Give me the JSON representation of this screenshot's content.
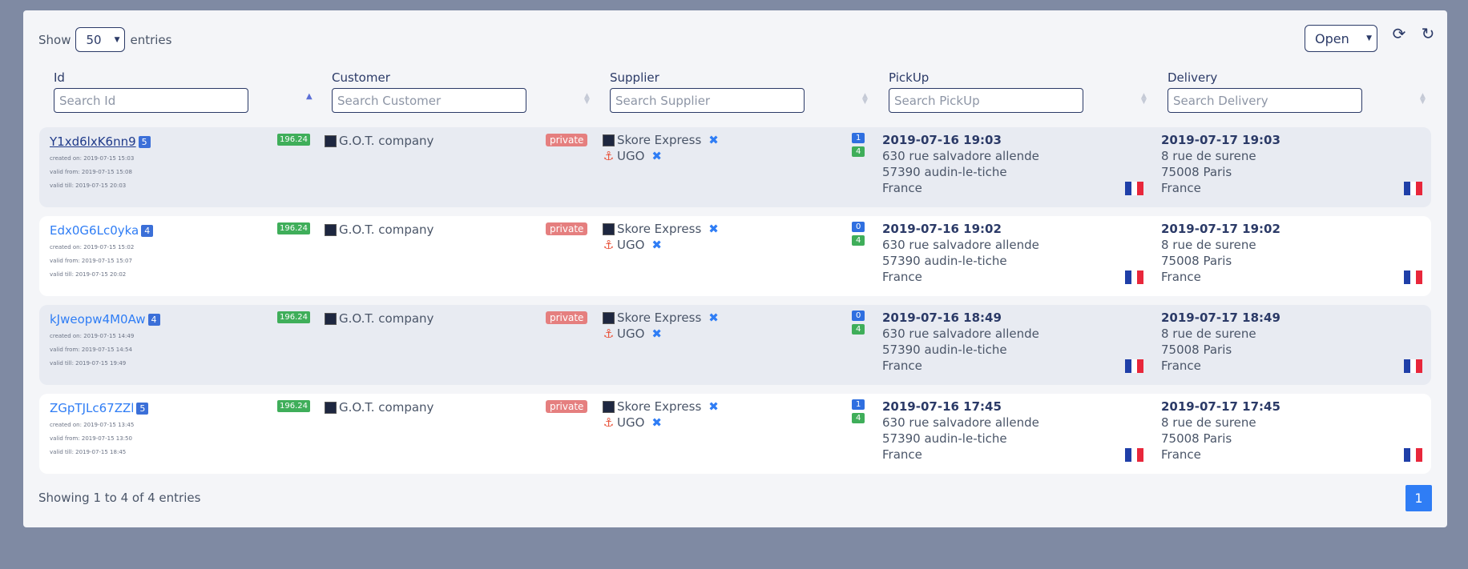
{
  "length_menu": {
    "show_label": "Show",
    "value": "50",
    "entries_label": "entries"
  },
  "status_filter": {
    "value": "Open"
  },
  "icons": {
    "refresh_sync": "refresh-sync-icon",
    "reload": "reload-icon"
  },
  "columns": [
    {
      "title": "Id",
      "placeholder": "Search Id"
    },
    {
      "title": "Customer",
      "placeholder": "Search Customer"
    },
    {
      "title": "Supplier",
      "placeholder": "Search Supplier"
    },
    {
      "title": "PickUp",
      "placeholder": "Search PickUp"
    },
    {
      "title": "Delivery",
      "placeholder": "Search Delivery"
    }
  ],
  "rows": [
    {
      "id": "Y1xd6lxK6nn9",
      "count": "5",
      "created": "created on: 2019-07-15 15:03",
      "valid_from": "valid from: 2019-07-15 15:08",
      "valid_till": "valid till: 2019-07-15 20:03",
      "price": "196.24",
      "customer": "G.O.T. company",
      "private": "private",
      "supplier1": "Skore Express",
      "supplier2": "UGO",
      "badge_top": "1",
      "badge_bottom": "4",
      "pickup": {
        "datetime": "2019-07-16 19:03",
        "street": "630 rue salvadore allende",
        "city": "57390 audin-le-tiche",
        "country": "France"
      },
      "delivery": {
        "datetime": "2019-07-17 19:03",
        "street": "8 rue de surene",
        "city": "75008 Paris",
        "country": "France"
      }
    },
    {
      "id": "Edx0G6Lc0yka",
      "count": "4",
      "created": "created on: 2019-07-15 15:02",
      "valid_from": "valid from: 2019-07-15 15:07",
      "valid_till": "valid till: 2019-07-15 20:02",
      "price": "196.24",
      "customer": "G.O.T. company",
      "private": "private",
      "supplier1": "Skore Express",
      "supplier2": "UGO",
      "badge_top": "0",
      "badge_bottom": "4",
      "pickup": {
        "datetime": "2019-07-16 19:02",
        "street": "630 rue salvadore allende",
        "city": "57390 audin-le-tiche",
        "country": "France"
      },
      "delivery": {
        "datetime": "2019-07-17 19:02",
        "street": "8 rue de surene",
        "city": "75008 Paris",
        "country": "France"
      }
    },
    {
      "id": "kJweopw4M0Aw",
      "count": "4",
      "created": "created on: 2019-07-15 14:49",
      "valid_from": "valid from: 2019-07-15 14:54",
      "valid_till": "valid till: 2019-07-15 19:49",
      "price": "196.24",
      "customer": "G.O.T. company",
      "private": "private",
      "supplier1": "Skore Express",
      "supplier2": "UGO",
      "badge_top": "0",
      "badge_bottom": "4",
      "pickup": {
        "datetime": "2019-07-16 18:49",
        "street": "630 rue salvadore allende",
        "city": "57390 audin-le-tiche",
        "country": "France"
      },
      "delivery": {
        "datetime": "2019-07-17 18:49",
        "street": "8 rue de surene",
        "city": "75008 Paris",
        "country": "France"
      }
    },
    {
      "id": "ZGpTJLc67ZZl",
      "count": "5",
      "created": "created on: 2019-07-15 13:45",
      "valid_from": "valid from: 2019-07-15 13:50",
      "valid_till": "valid till: 2019-07-15 18:45",
      "price": "196.24",
      "customer": "G.O.T. company",
      "private": "private",
      "supplier1": "Skore Express",
      "supplier2": "UGO",
      "badge_top": "1",
      "badge_bottom": "4",
      "pickup": {
        "datetime": "2019-07-16 17:45",
        "street": "630 rue salvadore allende",
        "city": "57390 audin-le-tiche",
        "country": "France"
      },
      "delivery": {
        "datetime": "2019-07-17 17:45",
        "street": "8 rue de surene",
        "city": "75008 Paris",
        "country": "France"
      }
    }
  ],
  "footer": {
    "info": "Showing 1 to 4 of 4 entries",
    "page": "1"
  },
  "colors": {
    "background": "#7f8aa3",
    "accent": "#2f7df5",
    "price_badge": "#3fae5a",
    "private_badge": "#e57f7f"
  }
}
